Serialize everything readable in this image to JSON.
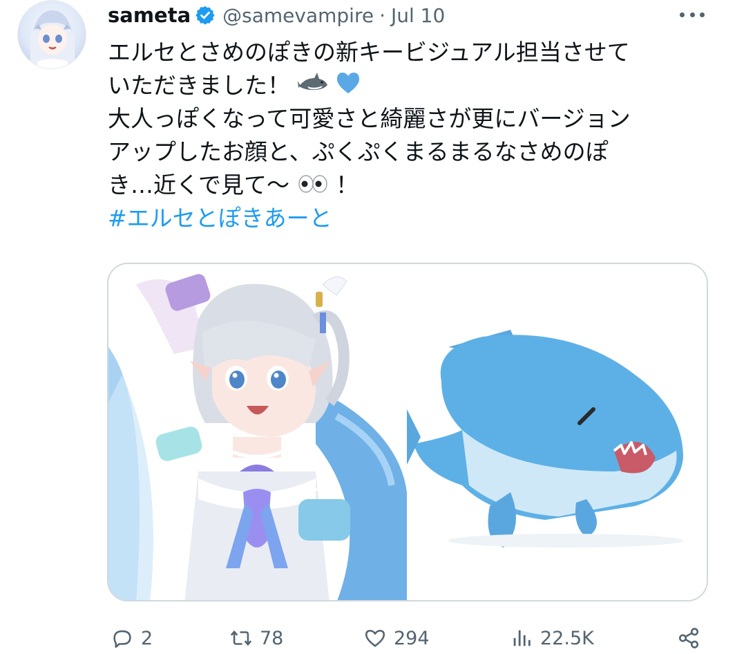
{
  "author": {
    "name": "sameta",
    "handle": "@samevampire",
    "separator": "·",
    "date": "Jul 10"
  },
  "tweet": {
    "lines": [
      "エルセとさめのぽきの新キービジュアル担当させて",
      "いただきました！",
      "大人っぽくなって可愛さと綺麗さが更にバージョン",
      "アップしたお顔と、ぷくぷくまるまるなさめのぽ",
      "き…近くで見て〜",
      "！"
    ],
    "hashtag": "#エルセとぽきあーと"
  },
  "metrics": {
    "replies": "2",
    "reposts": "78",
    "likes": "294",
    "views": "22.5K"
  },
  "colors": {
    "text": "#0f1419",
    "secondary": "#536471",
    "link": "#1d9bf0",
    "verified": "#1d9bf0",
    "border": "#cfd9de"
  },
  "icons": [
    "verified-badge-icon",
    "more-icon",
    "shark-emoji-icon",
    "blue-heart-emoji-icon",
    "eyes-emoji-icon",
    "reply-icon",
    "repost-icon",
    "like-icon",
    "views-icon",
    "share-icon"
  ]
}
